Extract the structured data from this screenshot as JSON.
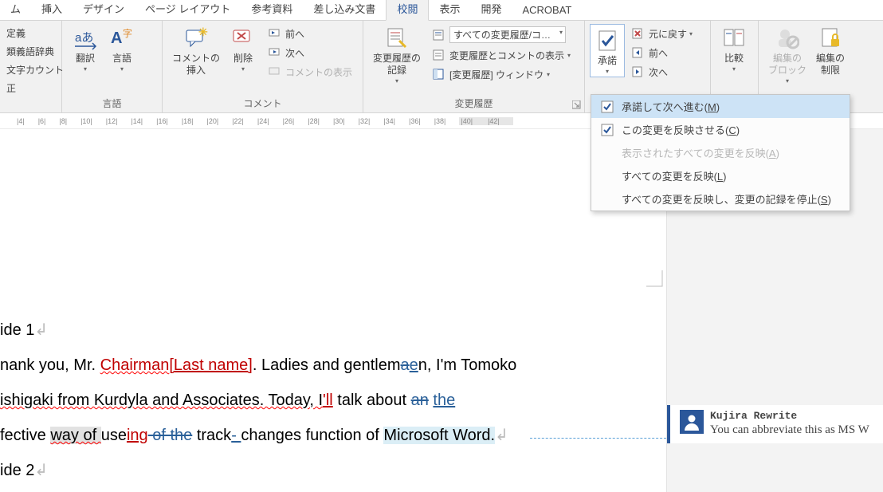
{
  "tabs": {
    "items": [
      "ム",
      "挿入",
      "デザイン",
      "ページ レイアウト",
      "参考資料",
      "差し込み文書",
      "校閲",
      "表示",
      "開発",
      "ACROBAT"
    ],
    "active_index": 6
  },
  "ribbon": {
    "proofing": {
      "items": [
        "定義",
        "類義語辞典",
        "文字カウント",
        "正"
      ]
    },
    "language": {
      "translate": "翻訳",
      "lang": "言語",
      "title": "言語"
    },
    "comments": {
      "insert": "コメントの\n挿入",
      "delete": "削除",
      "prev": "前へ",
      "next": "次へ",
      "show": "コメントの表示",
      "title": "コメント"
    },
    "tracking": {
      "log": "変更履歴の\n記録",
      "display_dd": "すべての変更履歴/コ…",
      "show_markup": "変更履歴とコメントの表示",
      "window": "[変更履歴] ウィンドウ",
      "title": "変更履歴"
    },
    "changes": {
      "accept": "承諾",
      "reject": "元に戻す",
      "prev": "前へ",
      "next": "次へ"
    },
    "compare": {
      "label": "比較"
    },
    "protect": {
      "block": "編集の\nブロック",
      "restrict": "編集の\n制限"
    }
  },
  "accept_menu": {
    "i0": {
      "label": "承諾して次へ進む(",
      "mnem": "M",
      "tail": ")"
    },
    "i1": {
      "label": "この変更を反映させる(",
      "mnem": "C",
      "tail": ")"
    },
    "i2": {
      "label": "表示されたすべての変更を反映(",
      "mnem": "A",
      "tail": ")"
    },
    "i3": {
      "label": "すべての変更を反映(",
      "mnem": "L",
      "tail": ")"
    },
    "i4": {
      "label": "すべての変更を反映し、変更の記録を停止(",
      "mnem": "S",
      "tail": ")"
    }
  },
  "ruler": {
    "ticks": [
      "",
      "|4|",
      "|6|",
      "|8|",
      "|10|",
      "|12|",
      "|14|",
      "|16|",
      "|18|",
      "|20|",
      "|22|",
      "|24|",
      "|26|",
      "|28|",
      "|30|",
      "|32|",
      "|34|",
      "|36|",
      "|38|",
      "|40|",
      "|42|"
    ]
  },
  "document": {
    "slide1": "ide 1",
    "line1a": "nank you, Mr. ",
    "line1_del": "Chairman",
    "line1_ins": "[Last name]",
    "line1b": ". Ladies and gentlem",
    "line1_a": "a",
    "line1_e": "e",
    "line1c": "n, I'm Tomoko ",
    "line2a": "ishigaki from Kurdyla and Associates. Today, I",
    "line2_ins": "'ll",
    "line2b": " talk about ",
    "line2_del": "an",
    "line2_ins2": "the",
    "line3a": "fective ",
    "line3_sel": "way of ",
    "line3b": "use",
    "line3_ins": "ing",
    "line3_del": " of the",
    "line3c": " track",
    "line3_dash": "- ",
    "line3d": "changes function of ",
    "line3_hl": "Microsoft Word.",
    "slide2": "ide 2"
  },
  "comment": {
    "author": "Kujira Rewrite",
    "body": "You can abbreviate this as MS W"
  }
}
